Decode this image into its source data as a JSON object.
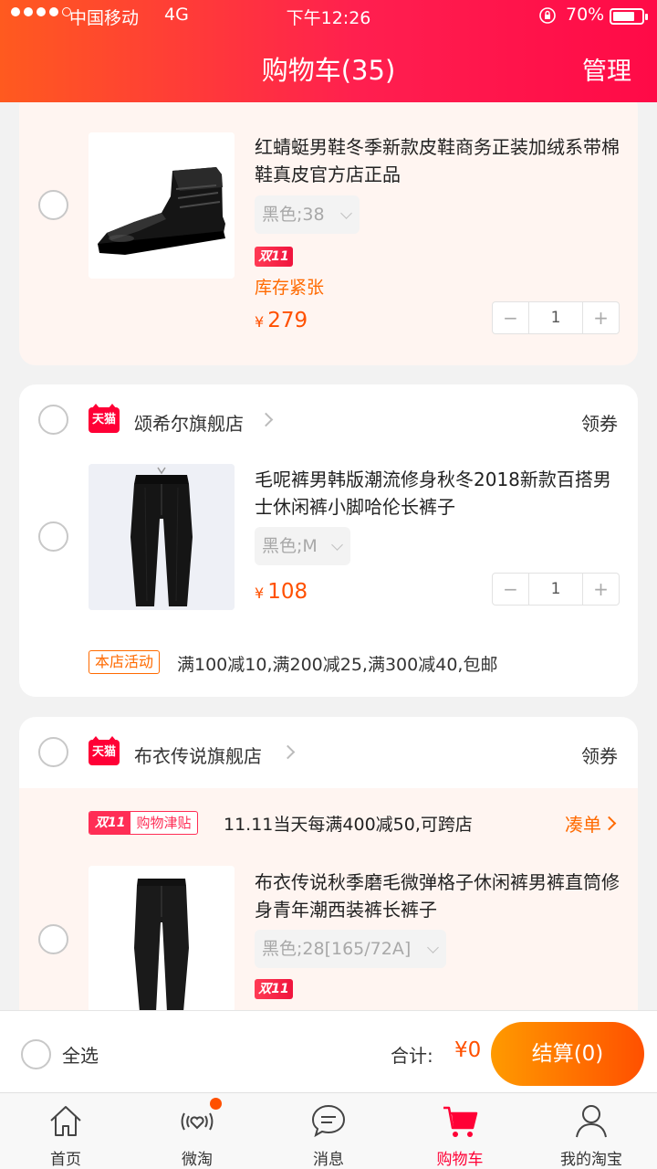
{
  "status_bar": {
    "carrier": "中国移动",
    "network": "4G",
    "time": "下午12:26",
    "battery": "70%"
  },
  "header": {
    "title": "购物车(35)",
    "manage": "管理"
  },
  "items": [
    {
      "name": "红蜻蜓男鞋冬季新款皮鞋商务正装加绒系带棉鞋真皮官方店正品",
      "sku": "黑色;38",
      "badge": "双11",
      "stock": "库存紧张",
      "currency": "¥",
      "price": "279",
      "qty": "1",
      "minus": "−",
      "plus": "+"
    },
    {
      "name": "毛呢裤男韩版潮流修身秋冬2018新款百搭男士休闲裤小脚哈伦长裤子",
      "sku": "黑色;M",
      "currency": "¥",
      "price": "108",
      "qty": "1",
      "minus": "−",
      "plus": "+"
    },
    {
      "name": "布衣传说秋季磨毛微弹格子休闲裤男裤直筒修身青年潮西装裤长裤子",
      "sku": "黑色;28[165/72A]",
      "badge": "双11"
    }
  ],
  "shops": [
    {
      "logo": "天猫",
      "name": "颂希尔旗舰店",
      "coupon": "领券",
      "promo_tag": "本店活动",
      "promo_text": "满100减10,满200减25,满300减40,包邮"
    },
    {
      "logo": "天猫",
      "name": "布衣传说旗舰店",
      "coupon": "领券"
    }
  ],
  "subsidy": {
    "tag_a": "双11",
    "tag_b": "购物津贴",
    "text": "11.11当天每满400减50,可跨店",
    "link": "凑单"
  },
  "checkout": {
    "select_all": "全选",
    "total_label": "合计:",
    "total": "¥0",
    "pay": "结算(0)"
  },
  "tabs": [
    {
      "label": "首页",
      "icon": "home-icon"
    },
    {
      "label": "微淘",
      "icon": "wetao-icon"
    },
    {
      "label": "消息",
      "icon": "message-icon"
    },
    {
      "label": "购物车",
      "icon": "cart-icon"
    },
    {
      "label": "我的淘宝",
      "icon": "profile-icon"
    }
  ],
  "colors": {
    "accent": "#ff0036",
    "price": "#ff5000",
    "header_start": "#ff5a1f",
    "header_end": "#ff0a47"
  }
}
